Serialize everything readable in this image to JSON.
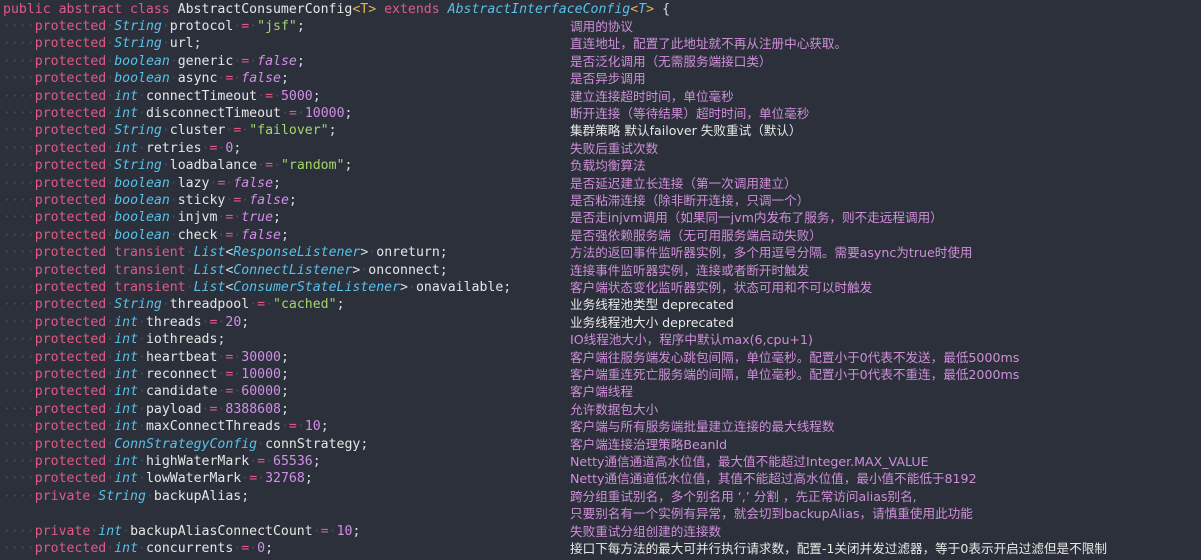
{
  "header": {
    "code": "public abstract class AbstractConsumerConfig<T> extends AbstractInterfaceConfig<T> {"
  },
  "lines": [
    {
      "mod": "protected",
      "type": "String",
      "name": "protocol",
      "value": "\"jsf\"",
      "vkind": "st",
      "desc": "调用的协议"
    },
    {
      "mod": "protected",
      "type": "String",
      "name": "url",
      "value": "",
      "vkind": "",
      "desc": "直连地址，配置了此地址就不再从注册中心获取。"
    },
    {
      "mod": "protected",
      "type": "boolean",
      "name": "generic",
      "value": "false",
      "vkind": "bool",
      "desc": "是否泛化调用（无需服务端接口类）"
    },
    {
      "mod": "protected",
      "type": "boolean",
      "name": "async",
      "value": "false",
      "vkind": "bool",
      "desc": "是否异步调用"
    },
    {
      "mod": "protected",
      "type": "int",
      "name": "connectTimeout",
      "value": "5000",
      "vkind": "nu",
      "desc": "建立连接超时时间，单位毫秒"
    },
    {
      "mod": "protected",
      "type": "int",
      "name": "disconnectTimeout",
      "value": "10000",
      "vkind": "nu",
      "desc": "断开连接（等待结果）超时时间，单位毫秒"
    },
    {
      "mod": "protected",
      "type": "String",
      "name": "cluster",
      "value": "\"failover\"",
      "vkind": "st",
      "desc": "集群策略 默认failover 失败重试（默认）",
      "alt": true
    },
    {
      "mod": "protected",
      "type": "int",
      "name": "retries",
      "value": "0",
      "vkind": "nu",
      "desc": "失败后重试次数"
    },
    {
      "mod": "protected",
      "type": "String",
      "name": "loadbalance",
      "value": "\"random\"",
      "vkind": "st",
      "desc": "负载均衡算法"
    },
    {
      "mod": "protected",
      "type": "boolean",
      "name": "lazy",
      "value": "false",
      "vkind": "bool",
      "desc": "是否延迟建立长连接（第一次调用建立）"
    },
    {
      "mod": "protected",
      "type": "boolean",
      "name": "sticky",
      "value": "false",
      "vkind": "bool",
      "desc": "是否粘滞连接（除非断开连接，只调一个）"
    },
    {
      "mod": "protected",
      "type": "boolean",
      "name": "injvm",
      "value": "true",
      "vkind": "bool",
      "desc": "是否走injvm调用（如果同一jvm内发布了服务，则不走远程调用）"
    },
    {
      "mod": "protected",
      "type": "boolean",
      "name": "check",
      "value": "false",
      "vkind": "bool",
      "desc": "是否强依赖服务端（无可用服务端启动失败）"
    },
    {
      "mod": "protected transient",
      "type": "List",
      "generic": "ResponseListener",
      "name": "onreturn",
      "value": "",
      "vkind": "",
      "desc": "方法的返回事件监听器实例，多个用逗号分隔。需要async为true时使用"
    },
    {
      "mod": "protected transient",
      "type": "List",
      "generic": "ConnectListener",
      "name": "onconnect",
      "value": "",
      "vkind": "",
      "desc": "连接事件监听器实例，连接或者断开时触发"
    },
    {
      "mod": "protected transient",
      "type": "List",
      "generic": "ConsumerStateListener",
      "name": "onavailable",
      "value": "",
      "vkind": "",
      "desc": "客户端状态变化监听器实例，状态可用和不可以时触发"
    },
    {
      "mod": "protected",
      "type": "String",
      "name": "threadpool",
      "value": "\"cached\"",
      "vkind": "st",
      "desc": "业务线程池类型 deprecated",
      "alt": true
    },
    {
      "mod": "protected",
      "type": "int",
      "name": "threads",
      "value": "20",
      "vkind": "nu",
      "desc": "业务线程池大小 deprecated",
      "alt": true
    },
    {
      "mod": "protected",
      "type": "int",
      "name": "iothreads",
      "value": "",
      "vkind": "",
      "desc": "IO线程池大小，程序中默认max(6,cpu+1)"
    },
    {
      "mod": "protected",
      "type": "int",
      "name": "heartbeat",
      "value": "30000",
      "vkind": "nu",
      "desc": "客户端往服务端发心跳包间隔，单位毫秒。配置小于0代表不发送，最低5000ms"
    },
    {
      "mod": "protected",
      "type": "int",
      "name": "reconnect",
      "value": "10000",
      "vkind": "nu",
      "desc": "客户端重连死亡服务端的间隔，单位毫秒。配置小于0代表不重连，最低2000ms"
    },
    {
      "mod": "protected",
      "type": "int",
      "name": "candidate",
      "value": "60000",
      "vkind": "nu",
      "desc": "客户端线程"
    },
    {
      "mod": "protected",
      "type": "int",
      "name": "payload",
      "value": "8388608",
      "vkind": "nu",
      "desc": "允许数据包大小"
    },
    {
      "mod": "protected",
      "type": "int",
      "name": "maxConnectThreads",
      "value": "10",
      "vkind": "nu",
      "desc": "客户端与所有服务端批量建立连接的最大线程数"
    },
    {
      "mod": "protected",
      "type": "ConnStrategyConfig",
      "name": "connStrategy",
      "value": "",
      "vkind": "",
      "desc": "客户端连接治理策略BeanId"
    },
    {
      "mod": "protected",
      "type": "int",
      "name": "highWaterMark",
      "value": "65536",
      "vkind": "nu",
      "desc": "Netty通信通道高水位值，最大值不能超过Integer.MAX_VALUE"
    },
    {
      "mod": "protected",
      "type": "int",
      "name": "lowWaterMark",
      "value": "32768",
      "vkind": "nu",
      "desc": "Netty通信通道低水位值，其值不能超过高水位值，最小值不能低于8192"
    },
    {
      "mod": "private",
      "type": "String",
      "name": "backupAlias",
      "value": "",
      "vkind": "",
      "desc": "跨分组重试别名，多个别名用 ‘,’ 分割 ，先正常访问alias别名,",
      "plain": true
    },
    {
      "mod": "",
      "type": "",
      "name": "",
      "value": "",
      "vkind": "",
      "desc": "只要别名有一个实例有异常，就会切到backupAlias，请慎重使用此功能"
    },
    {
      "mod": "private",
      "type": "int",
      "name": "backupAliasConnectCount",
      "value": "10",
      "vkind": "nu",
      "desc": "失败重试分组创建的连接数",
      "plain": true
    },
    {
      "mod": "protected",
      "type": "int",
      "name": "concurrents",
      "value": "0",
      "vkind": "nu",
      "desc": "接口下每方法的最大可并行执行请求数，配置-1关闭并发过滤器，等于0表示开启过滤但是不限制",
      "alt": true
    }
  ]
}
